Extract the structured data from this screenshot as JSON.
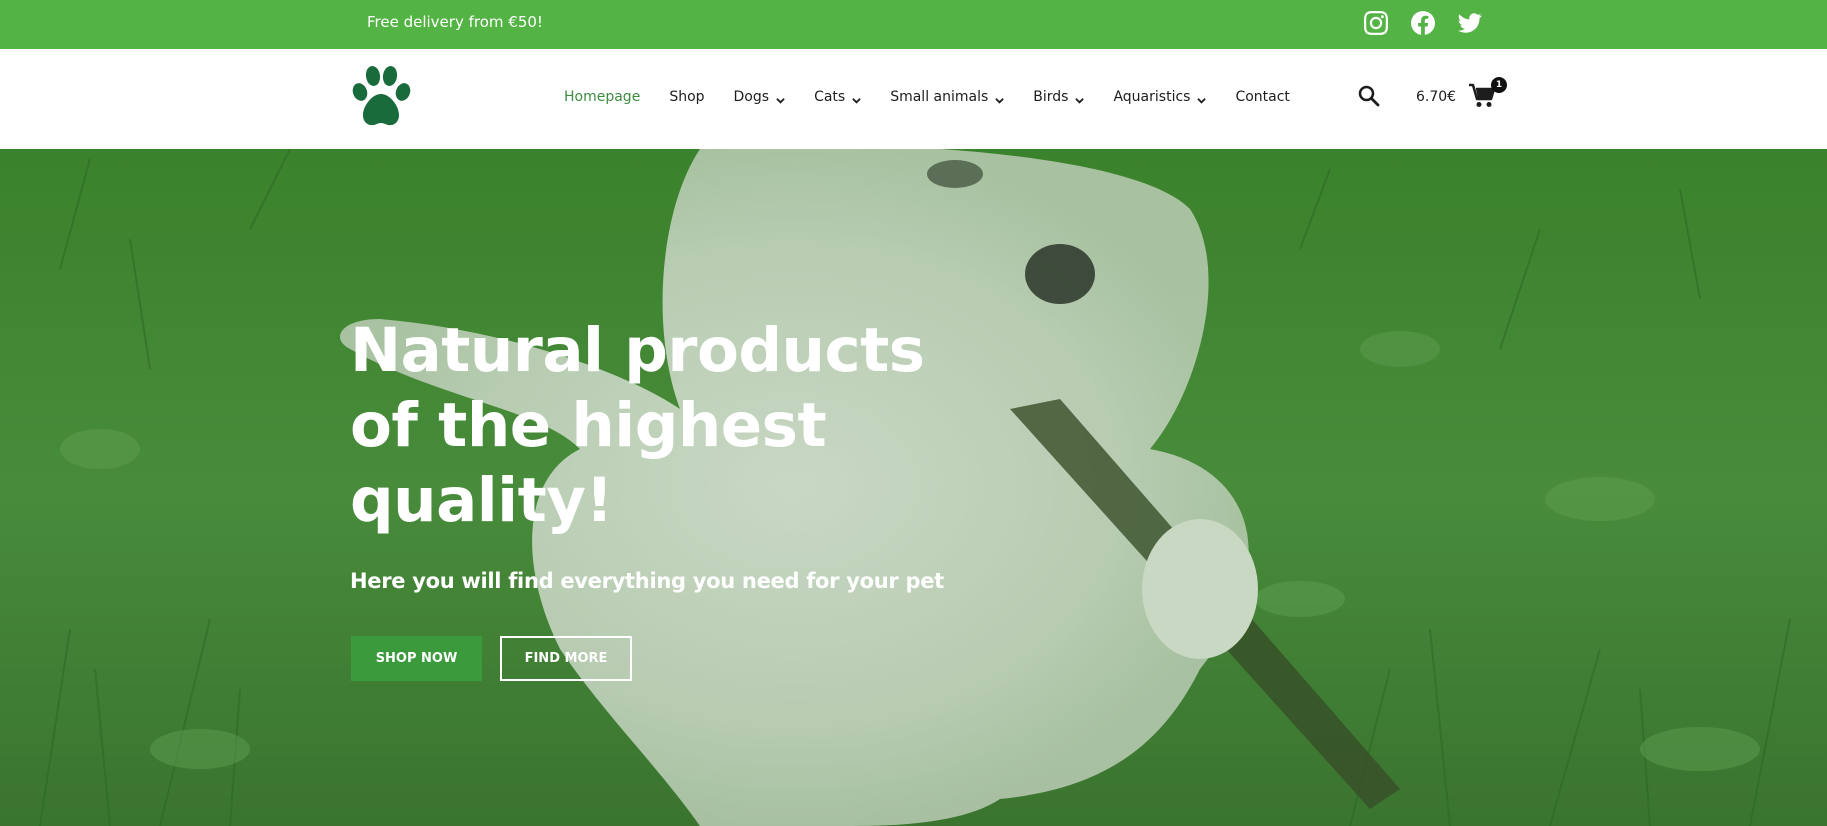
{
  "topbar": {
    "promo": "Free delivery from €50!",
    "socials": [
      {
        "icon": "instagram-icon"
      },
      {
        "icon": "facebook-icon"
      },
      {
        "icon": "twitter-icon"
      }
    ],
    "bg_color": "#54b345"
  },
  "header": {
    "logo_icon": "paw-icon",
    "logo_color": "#1a6b3c",
    "nav": [
      {
        "label": "Homepage",
        "active": true,
        "dropdown": false
      },
      {
        "label": "Shop",
        "active": false,
        "dropdown": false
      },
      {
        "label": "Dogs",
        "active": false,
        "dropdown": true
      },
      {
        "label": "Cats",
        "active": false,
        "dropdown": true
      },
      {
        "label": "Small animals",
        "active": false,
        "dropdown": true
      },
      {
        "label": "Birds",
        "active": false,
        "dropdown": true
      },
      {
        "label": "Aquaristics",
        "active": false,
        "dropdown": true
      },
      {
        "label": "Contact",
        "active": false,
        "dropdown": false
      }
    ],
    "cart_total": "6.70€",
    "cart_count": "1",
    "active_color": "#3d8c40"
  },
  "hero": {
    "title": "Natural products of the highest quality!",
    "subtitle": "Here you will find everything you need for your pet",
    "shop_button": "SHOP NOW",
    "find_button": "FIND MORE",
    "shop_button_color": "#3a9a3c"
  }
}
